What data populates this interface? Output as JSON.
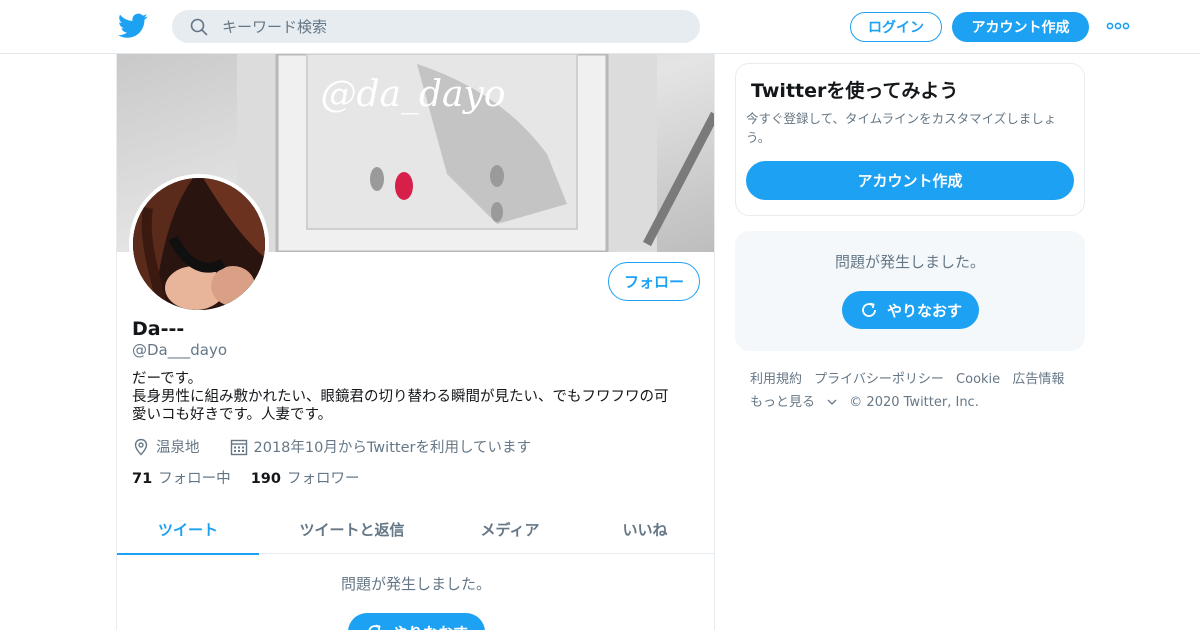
{
  "header": {
    "search_placeholder": "キーワード検索",
    "login_label": "ログイン",
    "signup_label": "アカウント作成"
  },
  "banner": {
    "watermark": "@da_dayo"
  },
  "profile": {
    "follow_label": "フォロー",
    "name": "Da---",
    "handle": "@Da___dayo",
    "bio_lines": [
      "だーです。",
      "長身男性に組み敷かれたい、眼鏡君の切り替わる瞬間が見たい、でもフワフワの可",
      "愛いコも好きです。人妻です。"
    ],
    "location": "温泉地",
    "joined": "2018年10月からTwitterを利用しています",
    "following_count": "71",
    "following_label": "フォロー中",
    "followers_count": "190",
    "followers_label": "フォロワー"
  },
  "tabs": [
    {
      "label": "ツイート"
    },
    {
      "label": "ツイートと返信"
    },
    {
      "label": "メディア"
    },
    {
      "label": "いいね"
    }
  ],
  "main_error": {
    "message": "問題が発生しました。",
    "retry_label": "やりなおす"
  },
  "sidebar": {
    "signup_card": {
      "title": "Twitterを使ってみよう",
      "description": "今すぐ登録して、タイムラインをカスタマイズしましょう。",
      "button_label": "アカウント作成"
    },
    "error_card": {
      "message": "問題が発生しました。",
      "retry_label": "やりなおす"
    },
    "footer_links": [
      "利用規約",
      "プライバシーポリシー",
      "Cookie",
      "広告情報"
    ],
    "footer_more": "もっと見る",
    "copyright": "© 2020 Twitter, Inc."
  },
  "colors": {
    "accent": "#1da1f2",
    "secondary_text": "#657786",
    "border": "#e6ecf0"
  }
}
